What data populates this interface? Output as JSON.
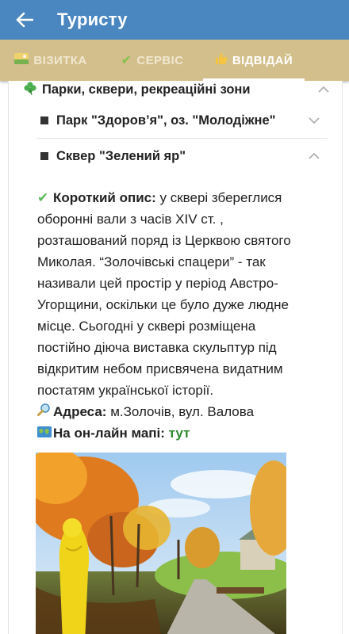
{
  "appbar": {
    "title": "Туристу"
  },
  "tabs": [
    {
      "icon": "id-card-icon",
      "label": "ВІЗИТКА"
    },
    {
      "icon": "check-mark-icon",
      "label": "СЕРВІС"
    },
    {
      "icon": "thumbs-up-icon",
      "label": "ВІДВІДАЙ"
    }
  ],
  "section": {
    "icon": "clover-icon",
    "title": "Парки, сквери, рекреаційні зони",
    "items": [
      {
        "title": "Парк \"Здоров’я\", оз. \"Молодіжне\"",
        "expanded": false
      },
      {
        "title": "Сквер \"Зелений яр\"",
        "expanded": true
      }
    ]
  },
  "details": {
    "desc_label": "Короткий опис:",
    "desc_first": " у сквері збереглися",
    "desc_lines": [
      "оборонні вали з часів XIV ст. ,",
      "розташований поряд із Церквою святого",
      "Миколая. “Золочівські спацери” - так",
      "називали цей простір у період Австро-",
      "Угорщини, оскільки це було дуже людне",
      "місце. Сьогодні у сквері розміщена",
      "постійно діюча  виставка скульптур під",
      "відкритим небом присвячена видатним",
      "постатям української історії."
    ],
    "address_label": "Адреса:",
    "address_value": " м.Золочів, вул. Валова",
    "map_label": "На он-лайн мапі:",
    "map_link": "тут"
  },
  "colors": {
    "appbar": "#4a86c0",
    "tabs": "#d3bf8b",
    "link": "#2f8a2f"
  }
}
